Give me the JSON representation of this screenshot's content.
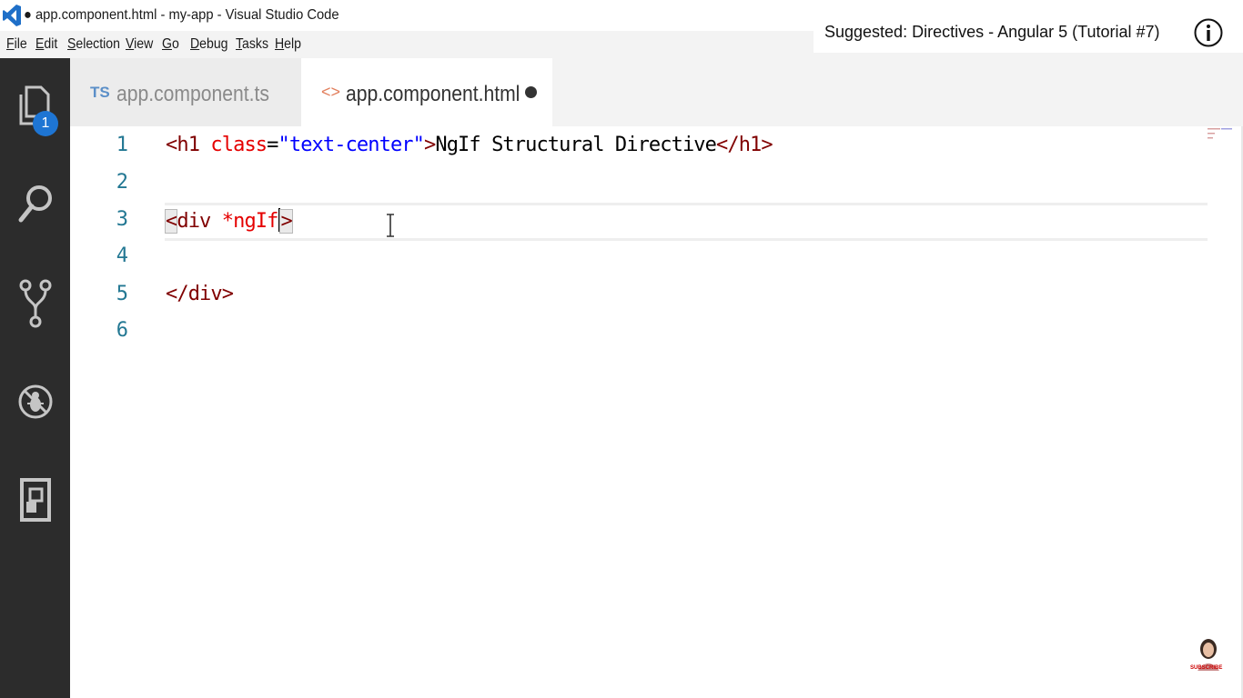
{
  "window": {
    "title": "● app.component.html - my-app - Visual Studio Code"
  },
  "menu": [
    {
      "label": "File",
      "u": "F",
      "rest": "ile"
    },
    {
      "label": "Edit",
      "u": "E",
      "rest": "dit"
    },
    {
      "label": "Selection",
      "u": "S",
      "rest": "election"
    },
    {
      "label": "View",
      "u": "V",
      "rest": "iew"
    },
    {
      "label": "Go",
      "u": "G",
      "rest": "o"
    },
    {
      "label": "Debug",
      "u": "D",
      "rest": "ebug"
    },
    {
      "label": "Tasks",
      "u": "T",
      "rest": "asks"
    },
    {
      "label": "Help",
      "u": "H",
      "rest": "elp"
    }
  ],
  "activity_bar": {
    "items": [
      "files-icon",
      "search-icon",
      "source-control-icon",
      "debug-icon",
      "extensions-icon"
    ],
    "badge": "1"
  },
  "tabs": [
    {
      "icon_text": "TS",
      "label": "app.component.ts",
      "active": false
    },
    {
      "icon_text": "<>",
      "label": "app.component.html",
      "active": true,
      "dirty": true
    }
  ],
  "editor": {
    "line_numbers": [
      "1",
      "2",
      "3",
      "4",
      "5",
      "6"
    ],
    "line1": {
      "open_tag": "<h1",
      "attr": "class",
      "eq": "=",
      "value": "\"text-center\"",
      "gt": ">",
      "text": "NgIf Structural Directive",
      "close_tag": "</h1>"
    },
    "line3": {
      "lt": "<",
      "tag": "div ",
      "attr": "*ngIf",
      "gt": ">"
    },
    "line5": {
      "close_tag": "</div>"
    }
  },
  "overlay": {
    "suggested": "Suggested: Directives - Angular 5 (Tutorial #7)",
    "subscribe": "SUBSCRIBE"
  },
  "colors": {
    "activity_bar": "#2c2c2c",
    "badge": "#1e75d3",
    "tag": "#800000",
    "attribute": "#e50000",
    "string": "#0000ff",
    "line_number": "#237893"
  }
}
